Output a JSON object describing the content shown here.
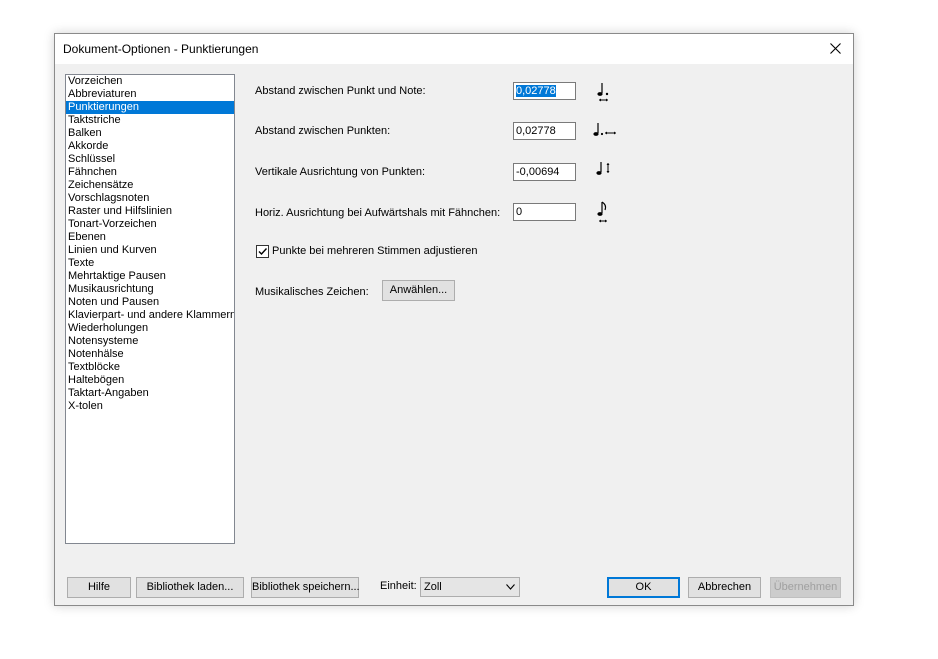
{
  "window": {
    "title": "Dokument-Optionen - Punktierungen"
  },
  "categories": [
    {
      "label": "Vorzeichen"
    },
    {
      "label": "Abbreviaturen"
    },
    {
      "label": "Punktierungen",
      "selected": true
    },
    {
      "label": "Taktstriche"
    },
    {
      "label": "Balken"
    },
    {
      "label": "Akkorde"
    },
    {
      "label": "Schlüssel"
    },
    {
      "label": "Fähnchen"
    },
    {
      "label": "Zeichensätze"
    },
    {
      "label": "Vorschlagsnoten"
    },
    {
      "label": "Raster und Hilfslinien"
    },
    {
      "label": "Tonart-Vorzeichen"
    },
    {
      "label": "Ebenen"
    },
    {
      "label": "Linien und Kurven"
    },
    {
      "label": "Texte"
    },
    {
      "label": "Mehrtaktige Pausen"
    },
    {
      "label": "Musikausrichtung"
    },
    {
      "label": "Noten und Pausen"
    },
    {
      "label": "Klavierpart- und andere Klammern"
    },
    {
      "label": "Wiederholungen"
    },
    {
      "label": "Notensysteme"
    },
    {
      "label": "Notenhälse"
    },
    {
      "label": "Textblöcke"
    },
    {
      "label": "Haltebögen"
    },
    {
      "label": "Taktart-Angaben"
    },
    {
      "label": "X-tolen"
    }
  ],
  "settings": {
    "dot_note_distance": {
      "label": "Abstand zwischen Punkt und Note:",
      "value": "0,02778",
      "icon": "dot-note-spacing-icon"
    },
    "dot_dot_distance": {
      "label": "Abstand zwischen Punkten:",
      "value": "0,02778",
      "icon": "dot-dot-spacing-icon"
    },
    "vertical_alignment": {
      "label": "Vertikale Ausrichtung von Punkten:",
      "value": "-0,00694",
      "icon": "vertical-alignment-icon"
    },
    "horizontal_alignment": {
      "label": "Horiz. Ausrichtung bei Aufwärtshals mit Fähnchen:",
      "value": "0",
      "icon": "flag-upstem-alignment-icon"
    },
    "adjust_multiple_voices": {
      "label": "Punkte bei mehreren Stimmen adjustieren",
      "checked": true
    },
    "music_symbol": {
      "label": "Musikalisches Zeichen:",
      "button": "Anwählen..."
    }
  },
  "footer": {
    "help": "Hilfe",
    "load_library": "Bibliothek laden...",
    "save_library": "Bibliothek speichern...",
    "unit_label": "Einheit:",
    "unit_value": "Zoll",
    "ok": "OK",
    "cancel": "Abbrechen",
    "apply": "Übernehmen"
  },
  "colors": {
    "selection": "#0078d7",
    "dialog_bg": "#f0f0f0",
    "default_button_border": "#0078d7"
  }
}
